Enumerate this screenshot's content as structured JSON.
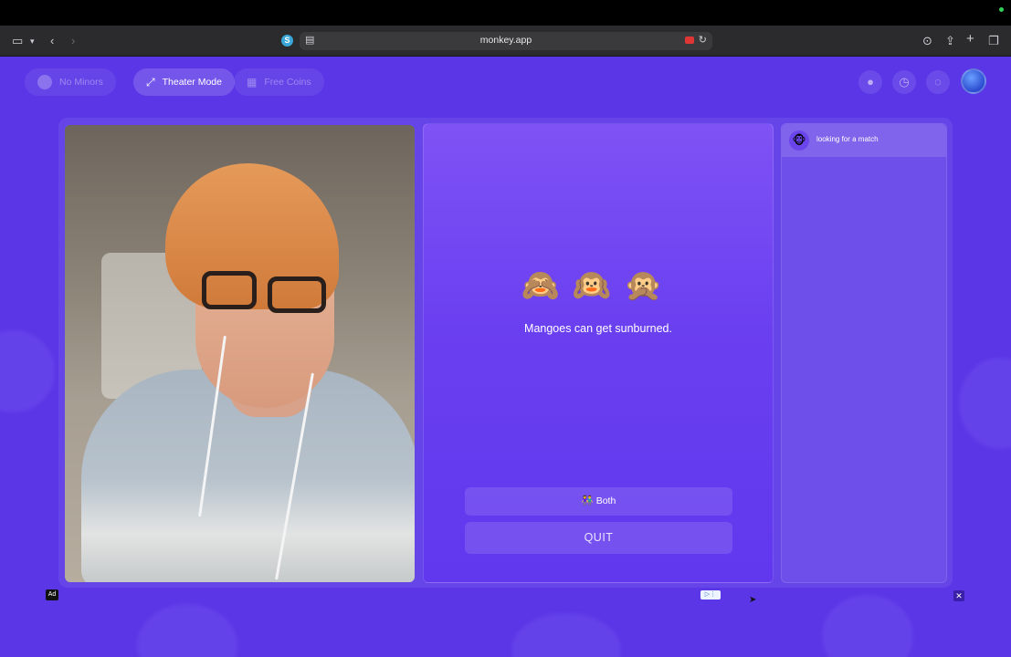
{
  "browser": {
    "url": "monkey.app",
    "site_icon_letter": "S"
  },
  "header": {
    "pills": [
      {
        "label": "No Minors"
      },
      {
        "label": "Theater Mode"
      },
      {
        "label": "Free Coins"
      }
    ]
  },
  "game": {
    "monkeys": "🙈🙉🙊",
    "fact": "Mangoes can get sunburned.",
    "both_emoji": "👫",
    "both_label": "Both",
    "quit_label": "QUIT"
  },
  "chat": {
    "status_icon": "🐵",
    "status_text": "looking for a match"
  },
  "ad": {
    "badge": "Ad",
    "close": "✕"
  },
  "colors": {
    "page_bg": "#5a36e6",
    "panel_accent": "#7f52f5",
    "browser_chrome": "#2b2b2d"
  }
}
